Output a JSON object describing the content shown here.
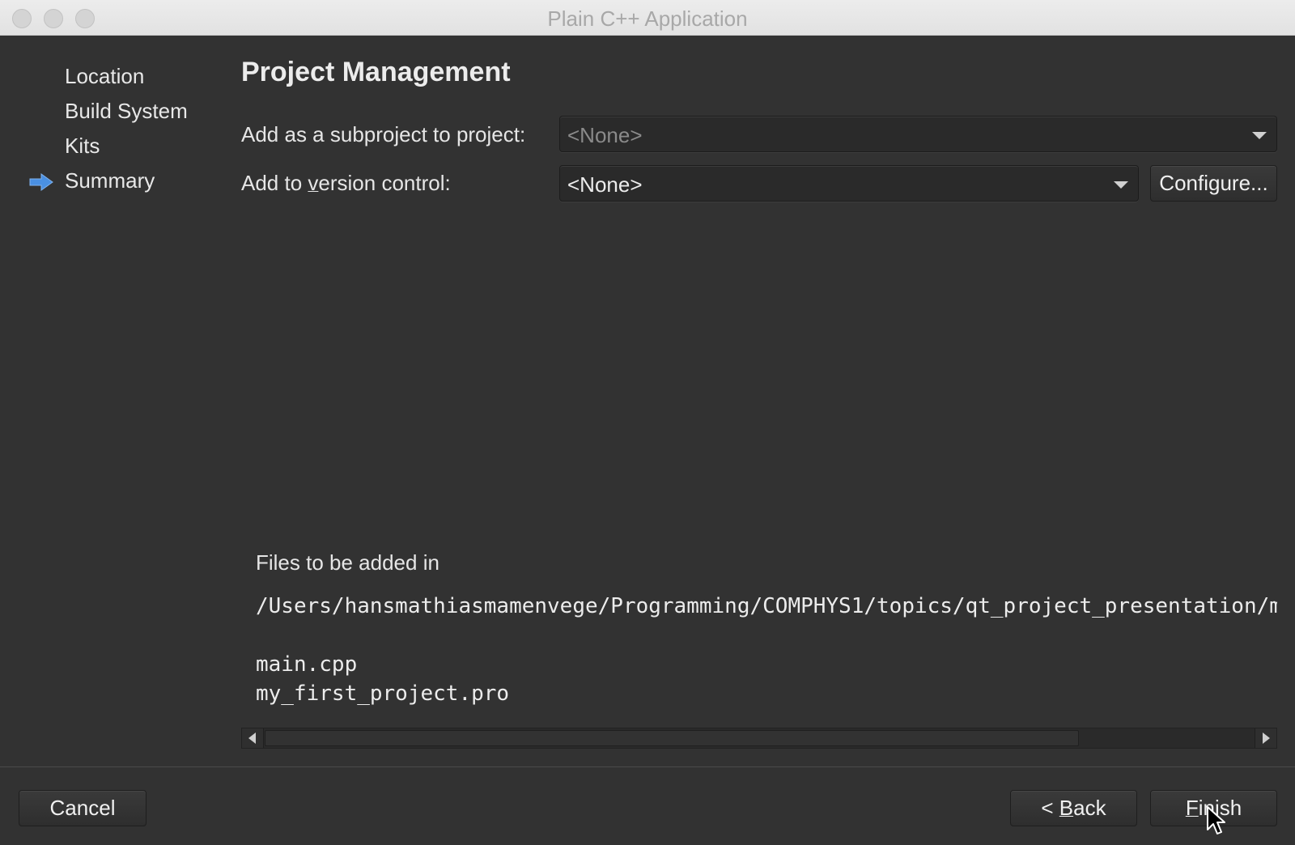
{
  "window": {
    "title": "Plain C++ Application"
  },
  "sidebar": {
    "items": [
      {
        "label": "Location"
      },
      {
        "label": "Build System"
      },
      {
        "label": "Kits"
      },
      {
        "label": "Summary",
        "current": true
      }
    ],
    "current_indicator_icon": "arrow-right-icon",
    "indicator_color": "#4a90e2"
  },
  "main": {
    "heading": "Project Management",
    "subproject": {
      "label": "Add as a subproject to project:",
      "value": "<None>",
      "enabled": false
    },
    "version_control": {
      "label_pre": "Add to ",
      "label_mnemonic": "v",
      "label_post": "ersion control:",
      "value": "<None>",
      "configure_label": "Configure..."
    },
    "files": {
      "heading": "Files to be added in",
      "path": "/Users/hansmathiasmamenvege/Programming/COMPHYS1/topics/qt_project_presentation/m",
      "list": [
        "main.cpp",
        "my_first_project.pro"
      ]
    }
  },
  "footer": {
    "cancel_label": "Cancel",
    "back_pre": "< ",
    "back_mnemonic": "B",
    "back_post": "ack",
    "finish_mnemonic": "F",
    "finish_post": "inish"
  }
}
